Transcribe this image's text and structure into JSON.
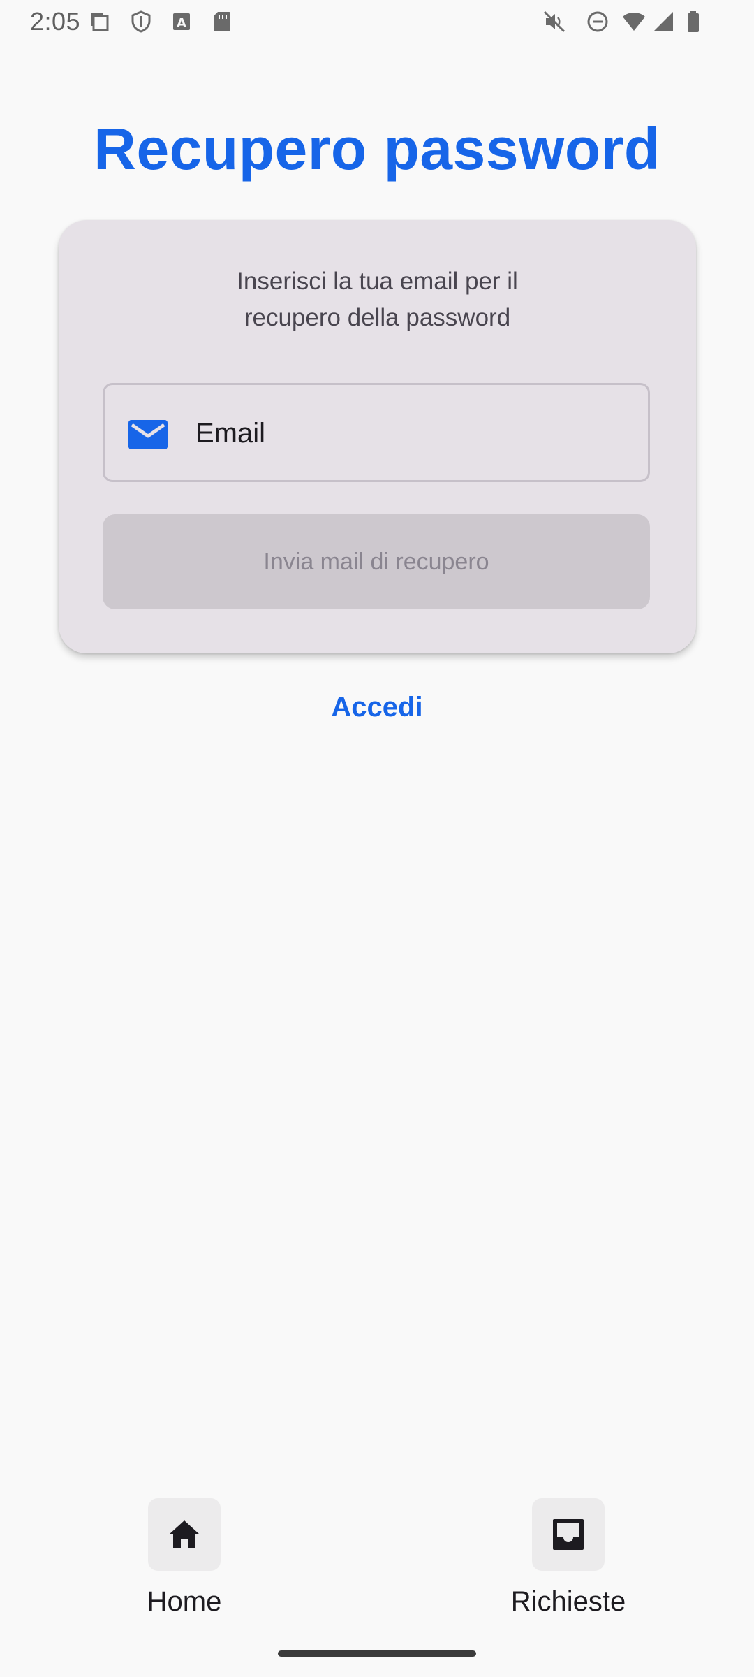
{
  "status_bar": {
    "time": "2:05",
    "left_icons": [
      "screenshot-icon",
      "shield-icon",
      "text-a-icon",
      "sd-card-icon"
    ],
    "right_icons": [
      "muted-icon",
      "do-not-disturb-icon",
      "wifi-icon",
      "signal-icon",
      "battery-icon"
    ]
  },
  "page": {
    "title": "Recupero password"
  },
  "card": {
    "description_line1": "Inserisci la tua email per il",
    "description_line2": "recupero della password",
    "email_label": "Email",
    "submit_label": "Invia mail di recupero"
  },
  "login_link": "Accedi",
  "bottom_nav": {
    "items": [
      {
        "label": "Home",
        "icon": "home-icon"
      },
      {
        "label": "Richieste",
        "icon": "inbox-icon"
      }
    ]
  },
  "colors": {
    "accent": "#1765e8",
    "card_background": "#e6e1e7",
    "page_background": "#f9f9f9",
    "disabled_button": "#cdc8ce"
  }
}
